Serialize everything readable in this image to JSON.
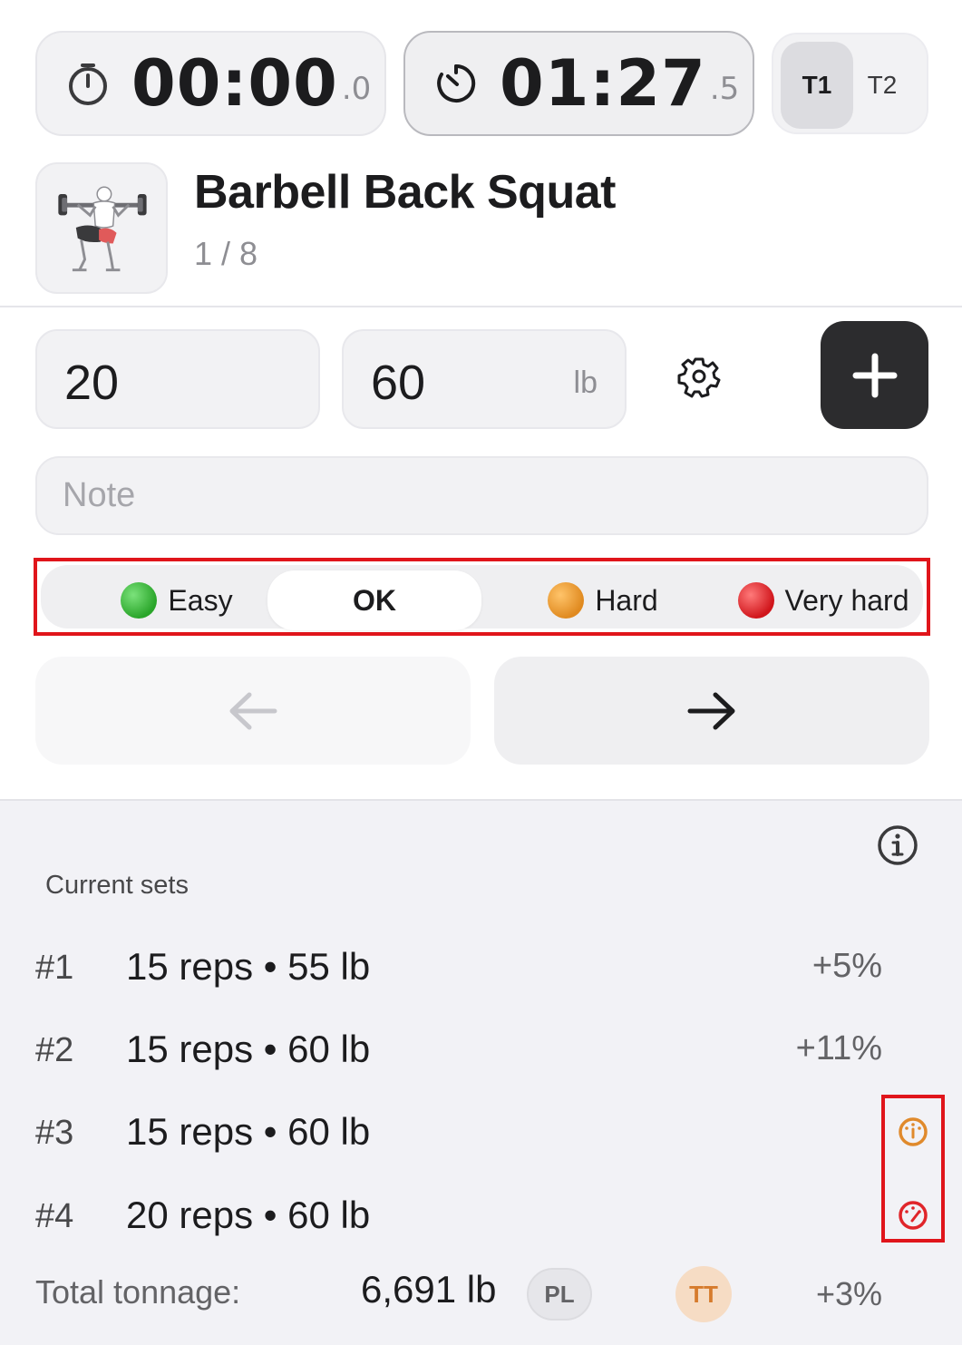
{
  "timers": {
    "stopwatch": {
      "main": "00:00",
      "fraction": ".0",
      "icon": "stopwatch-icon"
    },
    "rest": {
      "main": "01:27",
      "fraction": ".5",
      "icon": "timer-icon"
    },
    "toggle": {
      "options": [
        "T1",
        "T2"
      ],
      "selected": "T1"
    }
  },
  "exercise": {
    "title": "Barbell Back Squat",
    "position": "1 / 8",
    "thumbnail_icon": "squat-illustration"
  },
  "inputs": {
    "reps": "20",
    "weight": "60",
    "weight_unit": "lb",
    "settings_icon": "gear-icon",
    "add_icon": "plus-icon"
  },
  "note": {
    "placeholder": "Note",
    "value": ""
  },
  "difficulty": {
    "selected": "OK",
    "options": [
      {
        "label": "Easy",
        "color": "#34c759"
      },
      {
        "label": "OK",
        "color": ""
      },
      {
        "label": "Hard",
        "color": "#f0a030"
      },
      {
        "label": "Very hard",
        "color": "#e0252a"
      }
    ]
  },
  "navigation": {
    "prev_icon": "arrow-left-icon",
    "next_icon": "arrow-right-icon",
    "prev_enabled": false
  },
  "sets": {
    "label": "Current sets",
    "info_icon": "info-icon",
    "rows": [
      {
        "num": "#1",
        "desc": "15 reps • 55 lb",
        "pct": "+5%",
        "indicator": ""
      },
      {
        "num": "#2",
        "desc": "15 reps • 60 lb",
        "pct": "+11%",
        "indicator": ""
      },
      {
        "num": "#3",
        "desc": "15 reps • 60 lb",
        "pct": "",
        "indicator": "gauge-hard-icon",
        "indicator_color": "#e08a2c"
      },
      {
        "num": "#4",
        "desc": "20 reps • 60 lb",
        "pct": "",
        "indicator": "gauge-very-hard-icon",
        "indicator_color": "#e0252a"
      }
    ]
  },
  "totals": {
    "label": "Total tonnage:",
    "value": "6,691 lb",
    "badge_pl": "PL",
    "badge_tt": "TT",
    "pct": "+3%"
  }
}
